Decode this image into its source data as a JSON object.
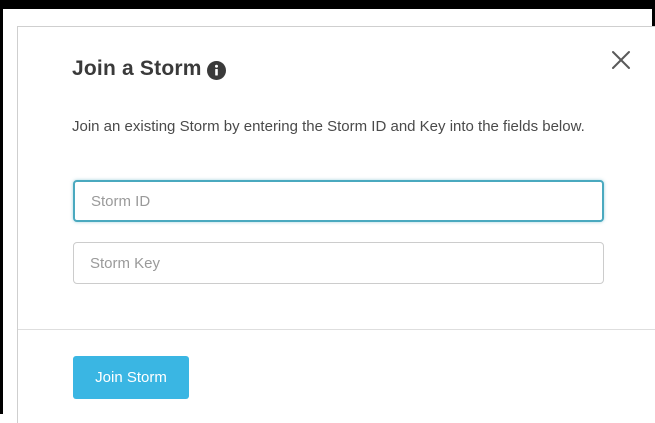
{
  "dialog": {
    "title": "Join a Storm",
    "info_icon": "info-icon",
    "close_icon": "close-icon",
    "description": "Join an existing Storm by entering the Storm ID and Key into the fields below.",
    "storm_id": {
      "placeholder": "Storm ID",
      "value": ""
    },
    "storm_key": {
      "placeholder": "Storm Key",
      "value": ""
    },
    "join_label": "Join Storm"
  },
  "colors": {
    "accent": "#3ab6e3",
    "focus_border": "#4aa9bf",
    "title": "#3a3a3a",
    "text": "#4a4a4a"
  }
}
